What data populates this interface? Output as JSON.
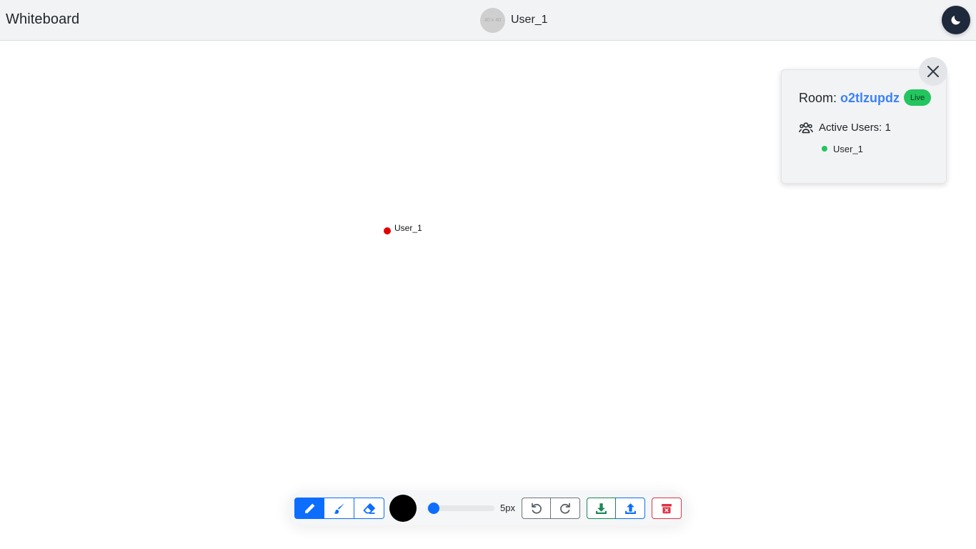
{
  "header": {
    "title": "Whiteboard",
    "avatar_placeholder": "40 x 40",
    "username": "User_1",
    "theme_toggle_icon": "moon-icon"
  },
  "canvas": {
    "cursor": {
      "label": "User_1",
      "color": "#e30000"
    }
  },
  "room_panel": {
    "room_prefix": "Room:",
    "room_id": "o2tlzupdz",
    "status_badge": "Live",
    "active_users_label": "Active Users: 1",
    "users": [
      {
        "name": "User_1",
        "status_color": "#22c55e"
      }
    ],
    "close_icon": "close-icon"
  },
  "toolbar": {
    "tools": [
      {
        "name": "pencil",
        "icon": "pencil-icon",
        "active": true
      },
      {
        "name": "brush",
        "icon": "brush-icon",
        "active": false
      },
      {
        "name": "eraser",
        "icon": "eraser-icon",
        "active": false
      }
    ],
    "color": "#000000",
    "brush_size": 5,
    "brush_size_label": "5px",
    "history": [
      {
        "name": "undo",
        "icon": "undo-icon"
      },
      {
        "name": "redo",
        "icon": "redo-icon"
      }
    ],
    "file": [
      {
        "name": "download",
        "icon": "download-icon"
      },
      {
        "name": "upload",
        "icon": "upload-icon"
      }
    ],
    "clear_icon": "trash-icon"
  },
  "colors": {
    "primary": "#0d6efd",
    "success": "#198754",
    "danger": "#dc3545",
    "live": "#22c55e",
    "room_id": "#3b82f6"
  }
}
